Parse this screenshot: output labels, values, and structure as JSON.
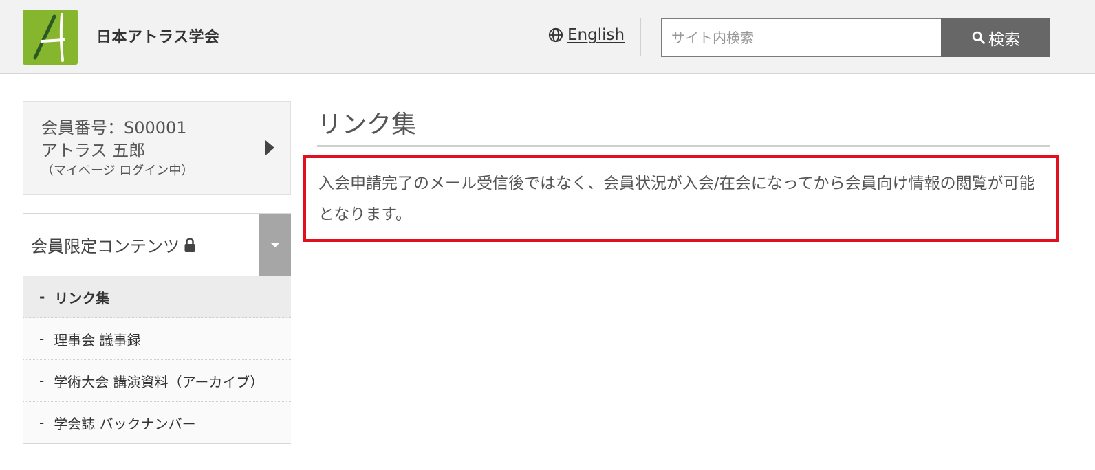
{
  "header": {
    "site_title": "日本アトラス学会",
    "language_link": "English",
    "search_placeholder": "サイト内検索",
    "search_button": "検索",
    "brand_color": "#86b52e"
  },
  "sidebar": {
    "member_card": {
      "member_number": "会員番号：S00001",
      "member_name": "アトラス 五郎",
      "login_status": "（マイページ ログイン中）"
    },
    "members_menu": {
      "title": "会員限定コンテンツ",
      "items": [
        {
          "label": "リンク集",
          "active": true
        },
        {
          "label": "理事会 議事録",
          "active": false
        },
        {
          "label": "学術大会 講演資料（アーカイブ）",
          "active": false
        },
        {
          "label": "学会誌 バックナンバー",
          "active": false
        }
      ]
    }
  },
  "main": {
    "page_title": "リンク集",
    "notice_text": "入会申請完了のメール受信後ではなく、会員状況が入会/在会になってから会員向け情報の閲覧が可能となります。",
    "notice_border_color": "#e0101f"
  }
}
